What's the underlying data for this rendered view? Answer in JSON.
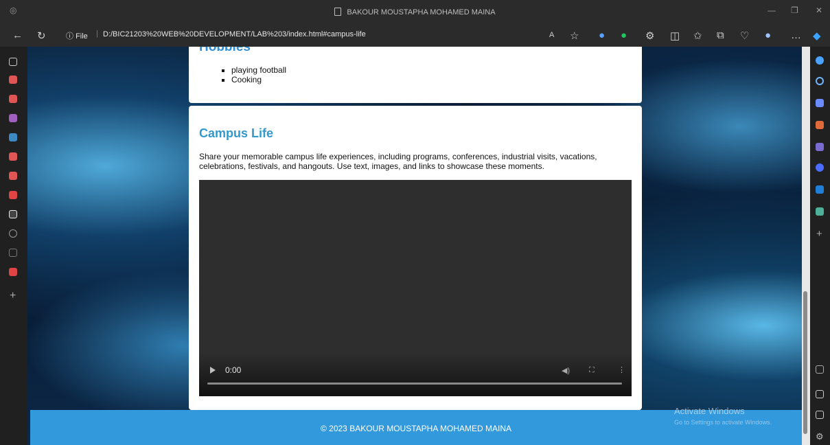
{
  "window": {
    "title": "BAKOUR MOUSTAPHA MOHAMED MAINA"
  },
  "addressbar": {
    "info_label": "File",
    "url": "D:/BIC21203%20WEB%20DEVELOPMENT/LAB%203/index.html#campus-life"
  },
  "page": {
    "hobbies": {
      "title": "Hobbies",
      "items": [
        "playing football",
        "Cooking"
      ]
    },
    "campus_life": {
      "title": "Campus Life",
      "description": "Share your memorable campus life experiences, including programs, conferences, industrial visits, vacations, celebrations, festivals, and hangouts. Use text, images, and links to showcase these moments."
    },
    "video": {
      "current_time": "0:00"
    },
    "footer": {
      "text": "© 2023 BAKOUR MOUSTAPHA MOHAMED MAINA"
    }
  },
  "os_overlay": {
    "activate_title": "Activate Windows",
    "activate_subtitle": "Go to Settings to activate Windows."
  },
  "colors": {
    "heading_blue": "#3399cc",
    "footer_blue": "#3399dd"
  }
}
